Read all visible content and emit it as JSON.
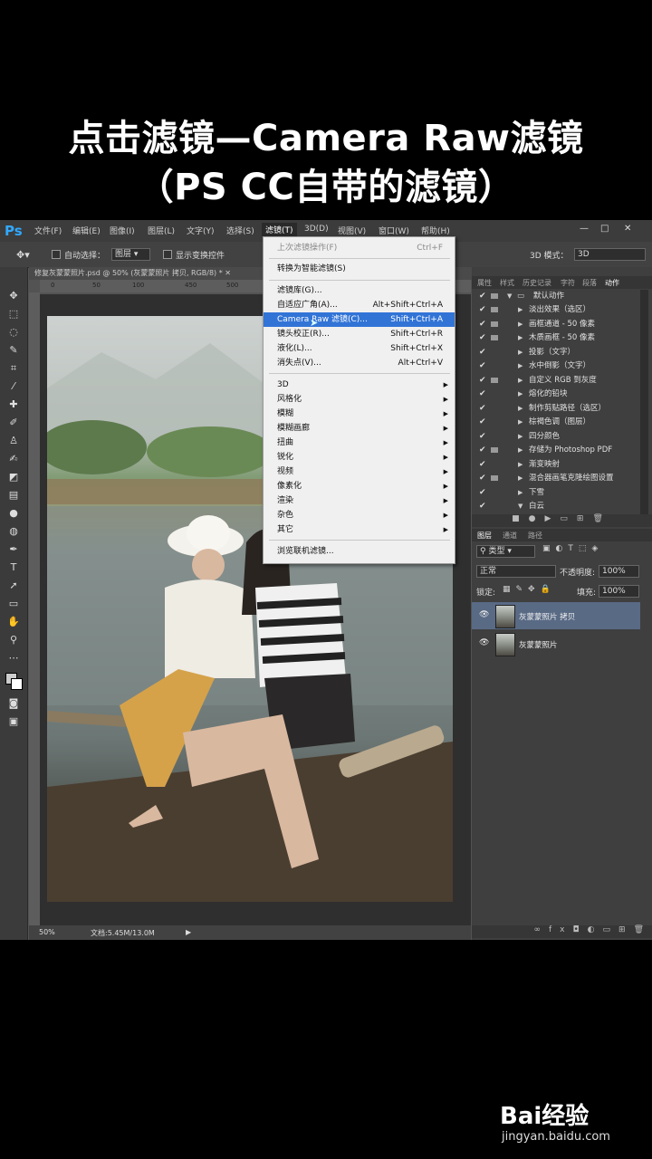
{
  "caption": {
    "line1": "点击滤镜—Camera Raw滤镜",
    "line2": "（PS CC自带的滤镜）"
  },
  "app": {
    "logo": "Ps"
  },
  "menubar": [
    {
      "label": "文件(F)"
    },
    {
      "label": "编辑(E)"
    },
    {
      "label": "图像(I)"
    },
    {
      "label": "图层(L)"
    },
    {
      "label": "文字(Y)"
    },
    {
      "label": "选择(S)"
    },
    {
      "label": "滤镜(T)"
    },
    {
      "label": "3D(D)"
    },
    {
      "label": "视图(V)"
    },
    {
      "label": "窗口(W)"
    },
    {
      "label": "帮助(H)"
    }
  ],
  "options": {
    "auto_select": "自动选择：",
    "auto_select_value": "图层",
    "show_transform": "显示变换控件",
    "mode_3d": "3D 模式：",
    "mode_3d_value": "3D"
  },
  "document": {
    "tab_title": "修复灰蒙蒙照片.psd @ 50% (灰蒙蒙照片 拷贝, RGB/8) *",
    "zoom": "50%",
    "doc_size": "文档:5.45M/13.0M",
    "ruler_marks": [
      "0",
      "50",
      "100",
      "450",
      "500"
    ]
  },
  "filter_menu": {
    "items": [
      {
        "label": "上次滤镜操作(F)",
        "shortcut": "Ctrl+F",
        "disabled": true
      },
      {
        "label": "转换为智能滤镜(S)",
        "shortcut": ""
      },
      {
        "label": "滤镜库(G)...",
        "shortcut": ""
      },
      {
        "label": "自适应广角(A)...",
        "shortcut": "Alt+Shift+Ctrl+A"
      },
      {
        "label": "Camera Raw 滤镜(C)...",
        "shortcut": "Shift+Ctrl+A",
        "highlighted": true
      },
      {
        "label": "镜头校正(R)...",
        "shortcut": "Shift+Ctrl+R"
      },
      {
        "label": "液化(L)...",
        "shortcut": "Shift+Ctrl+X"
      },
      {
        "label": "消失点(V)...",
        "shortcut": "Alt+Ctrl+V"
      },
      {
        "label": "3D",
        "submenu": true
      },
      {
        "label": "风格化",
        "submenu": true
      },
      {
        "label": "模糊",
        "submenu": true
      },
      {
        "label": "模糊画廊",
        "submenu": true
      },
      {
        "label": "扭曲",
        "submenu": true
      },
      {
        "label": "锐化",
        "submenu": true
      },
      {
        "label": "视频",
        "submenu": true
      },
      {
        "label": "像素化",
        "submenu": true
      },
      {
        "label": "渲染",
        "submenu": true
      },
      {
        "label": "杂色",
        "submenu": true
      },
      {
        "label": "其它",
        "submenu": true
      },
      {
        "label": "浏览联机滤镜...",
        "shortcut": ""
      }
    ]
  },
  "actions_panel": {
    "tabs": [
      "属性",
      "样式",
      "历史记录",
      "字符",
      "段落",
      "动作"
    ],
    "set_name": "默认动作",
    "items": [
      "淡出效果（选区）",
      "画框通道 - 50 像素",
      "木质画框 - 50 像素",
      "投影（文字）",
      "水中倒影（文字）",
      "自定义 RGB 到灰度",
      "熔化的铅块",
      "制作剪贴路径（选区）",
      "棕褐色调（图层）",
      "四分颜色",
      "存储为 Photoshop PDF",
      "渐变映射",
      "混合器画笔克隆绘图设置",
      "下雪",
      "白云"
    ]
  },
  "layers_panel": {
    "tabs": [
      "图层",
      "通道",
      "路径"
    ],
    "filter_type": "类型",
    "blend_mode": "正常",
    "opacity_label": "不透明度:",
    "opacity_value": "100%",
    "lock_label": "锁定:",
    "fill_label": "填充:",
    "fill_value": "100%",
    "layers": [
      {
        "name": "灰蒙蒙照片 拷贝",
        "selected": true
      },
      {
        "name": "灰蒙蒙照片",
        "selected": false
      }
    ]
  },
  "watermark": {
    "brand": "Bai经验",
    "url": "jingyan.baidu.com"
  }
}
